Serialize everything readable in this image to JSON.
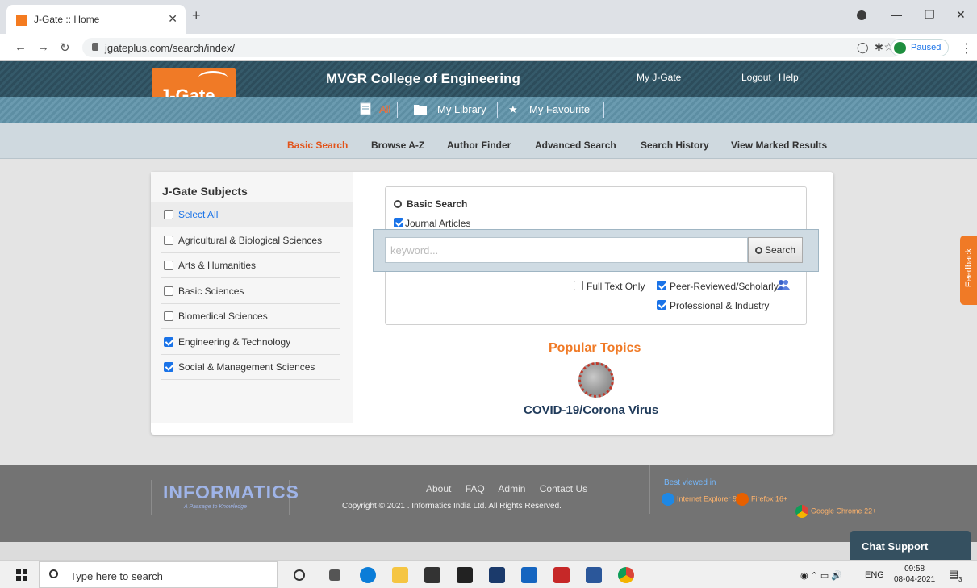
{
  "browser": {
    "tab_title": "J-Gate :: Home",
    "url": "jgateplus.com/search/index/",
    "profile_initial": "I",
    "profile_label": "Paused"
  },
  "header": {
    "logo_text": "J-Gate",
    "college": "MVGR College of Engineering",
    "my_jgate": "My J-Gate",
    "logout": "Logout",
    "help": "Help",
    "subnav": [
      "All",
      "My Library",
      "My Favourite"
    ]
  },
  "menu": [
    "Basic Search",
    "Browse A-Z",
    "Author Finder",
    "Advanced Search",
    "Search History",
    "View Marked Results"
  ],
  "subjects": {
    "title": "J-Gate Subjects",
    "items": [
      {
        "label": "Select All",
        "checked": false
      },
      {
        "label": "Agricultural & Biological Sciences",
        "checked": false
      },
      {
        "label": "Arts & Humanities",
        "checked": false
      },
      {
        "label": "Basic Sciences",
        "checked": false
      },
      {
        "label": "Biomedical Sciences",
        "checked": false
      },
      {
        "label": "Engineering & Technology",
        "checked": true
      },
      {
        "label": "Social & Management Sciences",
        "checked": true
      }
    ]
  },
  "search": {
    "title": "Basic Search",
    "journal_articles": "Journal Articles",
    "placeholder": "keyword...",
    "button": "Search",
    "full_text": "Full Text Only",
    "peer_reviewed": "Peer-Reviewed/Scholarly",
    "professional": "Professional & Industry"
  },
  "popular": {
    "title": "Popular Topics",
    "topic": "COVID-19/Corona Virus"
  },
  "feedback": "Feedback",
  "footer": {
    "brand": "INFORMATICS",
    "tagline": "A Passage to Knowledge",
    "links": [
      "About",
      "FAQ",
      "Admin",
      "Contact Us"
    ],
    "copyright": "Copyright © 2021 . Informatics India Ltd. All Rights Reserved.",
    "best_viewed": "Best viewed in",
    "browsers": [
      {
        "name": "Internet Explorer",
        "version": "9+"
      },
      {
        "name": "Firefox",
        "version": "16+"
      },
      {
        "name": "Google Chrome",
        "version": "22+"
      }
    ]
  },
  "chat": "Chat Support",
  "taskbar": {
    "search_placeholder": "Type here to search",
    "lang": "ENG",
    "time": "09:58",
    "date": "08-04-2021",
    "notification_count": "3"
  },
  "colors": {
    "brand_orange": "#f07a26",
    "header_dark": "#2d4d5c",
    "active_menu": "#e2541b",
    "link_blue": "#1a73e8"
  }
}
